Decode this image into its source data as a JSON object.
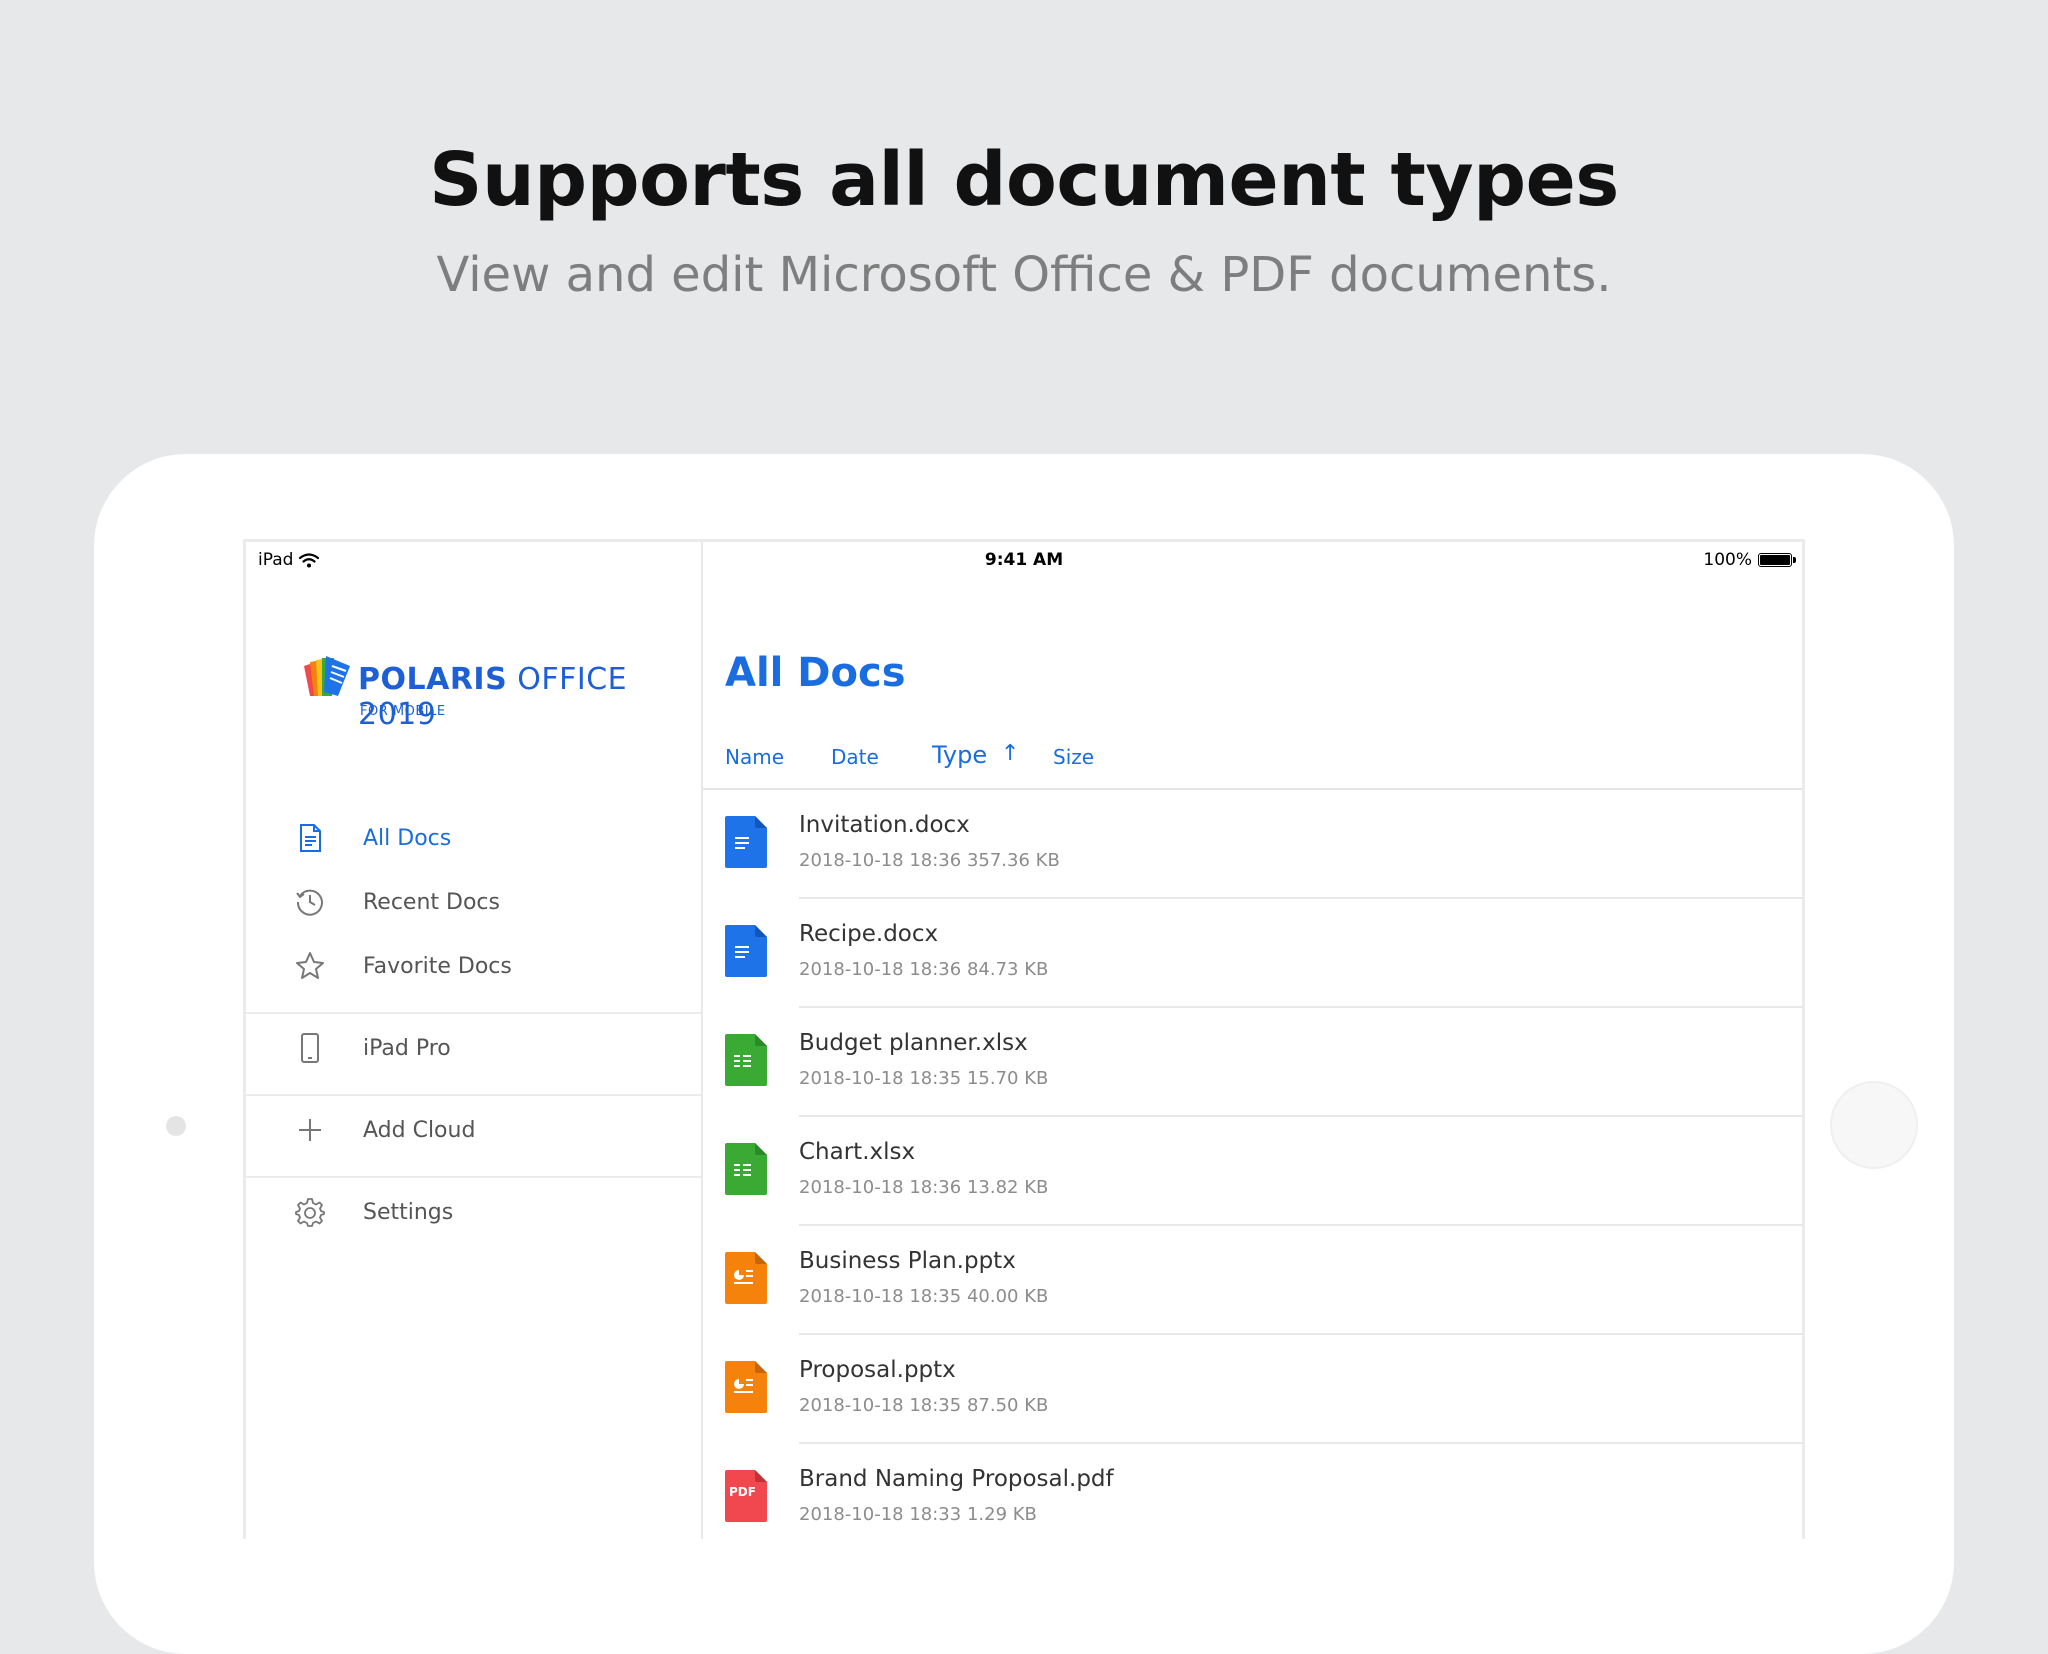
{
  "promo": {
    "headline": "Supports all document types",
    "subline": "View and edit Microsoft Office & PDF documents."
  },
  "status_bar": {
    "device": "iPad",
    "time": "9:41 AM",
    "battery": "100%"
  },
  "sidebar": {
    "logo_title_a": "POLARIS",
    "logo_title_b": " OFFICE 2019",
    "logo_sub": "FOR MOBILE",
    "items": [
      {
        "label": "All Docs",
        "icon": "document-icon",
        "active": true
      },
      {
        "label": "Recent Docs",
        "icon": "history-icon"
      },
      {
        "label": "Favorite Docs",
        "icon": "star-icon"
      },
      {
        "label": "iPad Pro",
        "icon": "tablet-icon"
      },
      {
        "label": "Add Cloud",
        "icon": "plus-icon"
      },
      {
        "label": "Settings",
        "icon": "gear-icon"
      }
    ]
  },
  "main": {
    "title": "All Docs",
    "sort": {
      "name": "Name",
      "date": "Date",
      "type": "Type",
      "type_arrow": "↑",
      "size": "Size"
    },
    "files": [
      {
        "name": "Invitation.docx",
        "date": "2018-10-18 18:36",
        "size": "357.36 KB",
        "type": "docx"
      },
      {
        "name": "Recipe.docx",
        "date": "2018-10-18 18:36",
        "size": "84.73 KB",
        "type": "docx"
      },
      {
        "name": "Budget planner.xlsx",
        "date": "2018-10-18 18:35",
        "size": "15.70 KB",
        "type": "xlsx"
      },
      {
        "name": "Chart.xlsx",
        "date": "2018-10-18 18:36",
        "size": "13.82 KB",
        "type": "xlsx"
      },
      {
        "name": "Business Plan.pptx",
        "date": "2018-10-18 18:35",
        "size": "40.00 KB",
        "type": "pptx"
      },
      {
        "name": "Proposal.pptx",
        "date": "2018-10-18 18:35",
        "size": "87.50 KB",
        "type": "pptx"
      },
      {
        "name": "Brand Naming Proposal.pdf",
        "date": "2018-10-18 18:33",
        "size": "1.29 KB",
        "type": "pdf",
        "icon_label": "PDF"
      }
    ]
  },
  "colors": {
    "accent": "#1a6de0",
    "docx": "#1f73e8",
    "xlsx": "#3aaa35",
    "pptx": "#f5820b",
    "pdf": "#f0484e"
  }
}
